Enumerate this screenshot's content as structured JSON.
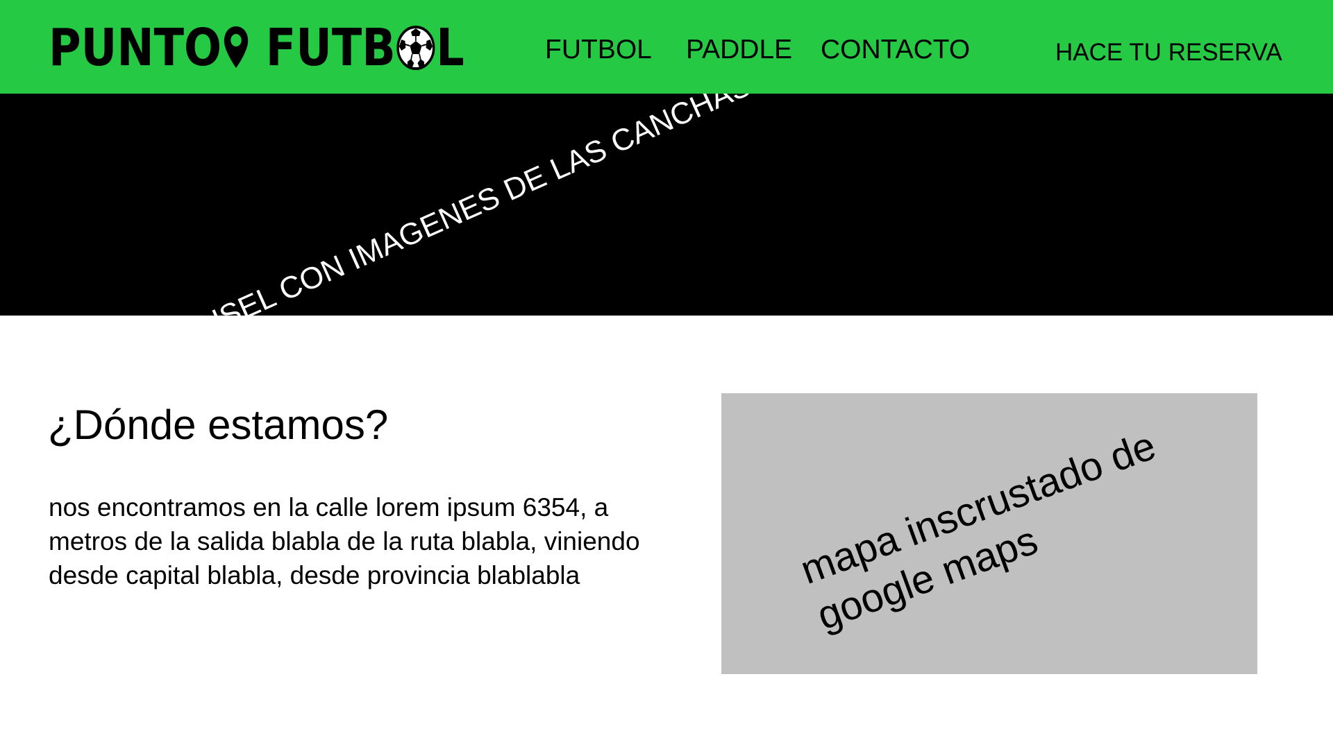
{
  "header": {
    "logo": {
      "word1": "PUNTO",
      "word2_prefix": "FUTB",
      "word2_suffix": "L"
    },
    "nav": {
      "futbol": "FUTBOL",
      "paddle": "PADDLE",
      "contacto": "CONTACTO",
      "reserva": "HACE TU RESERVA"
    },
    "colors": {
      "background": "#25c943",
      "text": "#000000"
    }
  },
  "carousel": {
    "placeholder_text": "CARROUSEL CON IMAGENES DE LAS CANCHAS",
    "background": "#000000",
    "text_color": "#ffffff"
  },
  "location": {
    "title": "¿Dónde estamos?",
    "description": "nos encontramos en la calle lorem ipsum 6354, a metros de la salida blabla de la ruta blabla, viniendo desde capital blabla, desde provincia blablabla",
    "map_placeholder": "mapa inscrustado de google maps",
    "map_background": "#c0c0c0"
  }
}
